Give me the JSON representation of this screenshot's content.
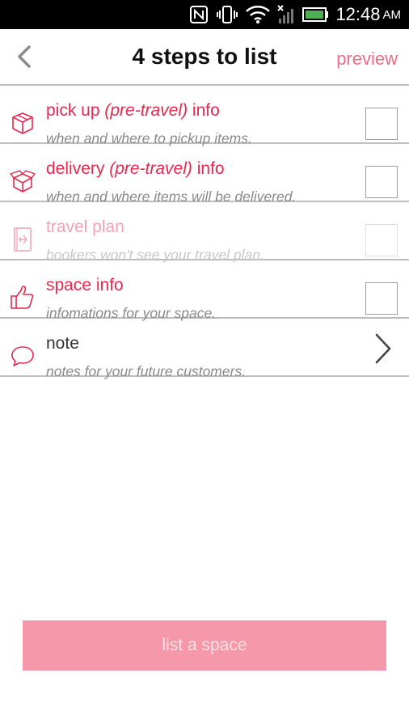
{
  "status_bar": {
    "time": "12:48",
    "ampm": "AM",
    "icons": [
      "nfc-icon",
      "vibrate-icon",
      "wifi-icon",
      "signal-icon",
      "battery-icon"
    ],
    "battery_color": "#4caf50"
  },
  "header": {
    "title": "4 steps to list",
    "preview_label": "preview",
    "back_icon": "chevron-left-icon"
  },
  "steps": [
    {
      "title_pre": "pick up ",
      "title_em": "(pre-travel)",
      "title_post": " info",
      "subtitle": "when and where to pickup items.",
      "icon": "box-closed-icon",
      "checked": false
    },
    {
      "title_pre": "delivery ",
      "title_em": "(pre-travel)",
      "title_post": " info",
      "subtitle": "when and where items will be delivered.",
      "icon": "box-open-icon",
      "checked": false
    },
    {
      "title_pre": "travel plan",
      "subtitle": "bookers won't see your travel plan.",
      "icon": "passport-icon",
      "checked": false,
      "disabled": true
    },
    {
      "title_pre": "space info",
      "subtitle": "infomations for your space.",
      "icon": "thumbs-up-icon",
      "checked": false
    },
    {
      "title_pre": "note",
      "subtitle": "notes for your future customers.",
      "icon": "speech-bubble-icon",
      "action_icon": "chevron-right-icon"
    }
  ],
  "cta": {
    "label": "list a space"
  },
  "colors": {
    "accent": "#e8294f",
    "accent_light": "#f06d8a",
    "cta_bg": "#f598a9",
    "divider": "#bdbdbd"
  }
}
